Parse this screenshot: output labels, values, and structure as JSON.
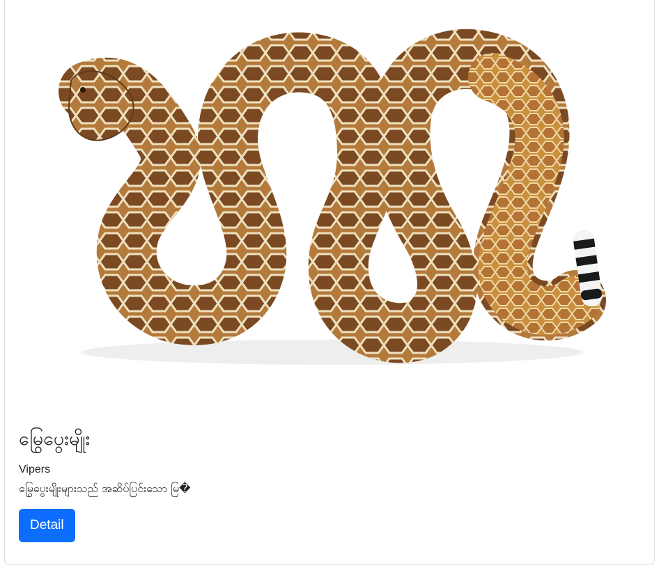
{
  "card": {
    "image": {
      "icon": "rattlesnake-photo",
      "accent_colors": {
        "body_tan": "#b77e3a",
        "blotch_brown": "#7a4a24",
        "belly_cream": "#efe1c0",
        "tail_band_black": "#1a1a1a"
      }
    },
    "title": "မြွေပွေးမျိုး",
    "subtitle": "Vipers",
    "description": "မြွေပွေးမျိုးများသည် အဆိပ်ပြင်းသော မြ�",
    "button_label": "Detail",
    "button_color": "#0d6efd"
  }
}
